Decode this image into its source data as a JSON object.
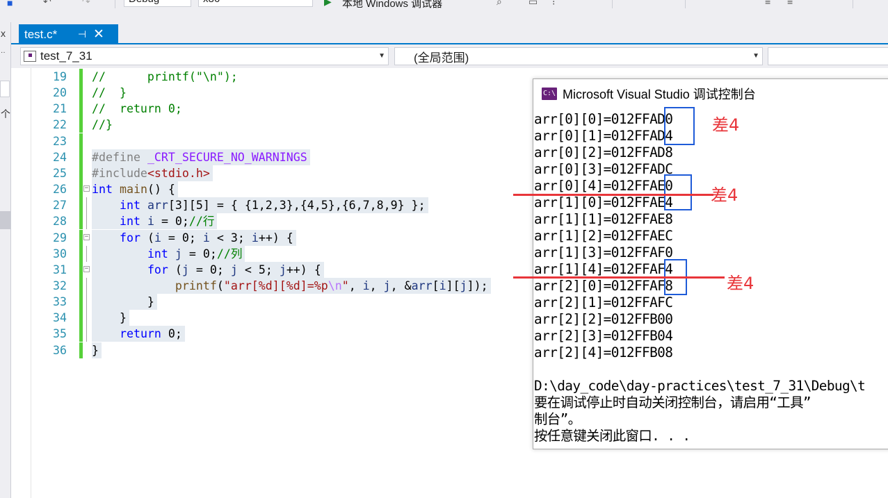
{
  "toolbar": {
    "config_value": "Debug",
    "platform_value": "x86",
    "run_label": "本地 Windows 调试器"
  },
  "left_strip": {
    "top_glyph": "x",
    "side_text": "个"
  },
  "tab": {
    "title": "test.c*",
    "pin_glyph": "⊣",
    "close_glyph": "✕"
  },
  "navbar": {
    "project_value": "test_7_31",
    "scope_value": "(全局范围)"
  },
  "editor": {
    "lines": [
      {
        "num": "19",
        "html": "<span class=\"tk-cm\">//      printf(\"\\n\");</span>"
      },
      {
        "num": "20",
        "html": "<span class=\"tk-cm\">//  }</span>"
      },
      {
        "num": "21",
        "html": "<span class=\"tk-cm\">//  return 0;</span>"
      },
      {
        "num": "22",
        "html": "<span class=\"tk-cm\">//}</span>"
      },
      {
        "num": "23",
        "html": ""
      },
      {
        "num": "24",
        "html": "<span class=\"tk-pp\">#define </span><span class=\"tk-mac\">_CRT_SECURE_NO_WARNINGS</span>"
      },
      {
        "num": "25",
        "html": "<span class=\"tk-pp\">#include</span><span class=\"tk-str\">&lt;stdio.h&gt;</span>"
      },
      {
        "num": "26",
        "html": "<span class=\"tk-kw\">int</span> <span class=\"tk-fn\">main</span>() {"
      },
      {
        "num": "27",
        "html": "    <span class=\"tk-kw\">int</span> <span class=\"tk-var\">arr</span>[3][5] = { {1,2,3},{4,5},{6,7,8,9} };"
      },
      {
        "num": "28",
        "html": "    <span class=\"tk-kw\">int</span> <span class=\"tk-var\">i</span> = 0;<span class=\"tk-cm\">//行</span>"
      },
      {
        "num": "29",
        "html": "    <span class=\"tk-kw\">for</span> (<span class=\"tk-var\">i</span> = 0; <span class=\"tk-var\">i</span> &lt; 3; <span class=\"tk-var\">i</span>++) {"
      },
      {
        "num": "30",
        "html": "        <span class=\"tk-kw\">int</span> <span class=\"tk-var\">j</span> = 0;<span class=\"tk-cm\">//列</span>"
      },
      {
        "num": "31",
        "html": "        <span class=\"tk-kw\">for</span> (<span class=\"tk-var\">j</span> = 0; <span class=\"tk-var\">j</span> &lt; 5; <span class=\"tk-var\">j</span>++) {"
      },
      {
        "num": "32",
        "html": "            <span class=\"tk-fn\">printf</span>(<span class=\"tk-str\">\"arr[%d][%d]=%p</span><span class=\"tk-esc\">\\n</span><span class=\"tk-str\">\"</span>, <span class=\"tk-var\">i</span>, <span class=\"tk-var\">j</span>, &amp;<span class=\"tk-var\">arr</span>[<span class=\"tk-var\">i</span>][<span class=\"tk-var\">j</span>]);"
      },
      {
        "num": "33",
        "html": "        }"
      },
      {
        "num": "34",
        "html": "    }"
      },
      {
        "num": "35",
        "html": "    <span class=\"tk-kw\">return</span> 0;"
      },
      {
        "num": "36",
        "html": "}"
      }
    ]
  },
  "console": {
    "title": "Microsoft Visual Studio 调试控制台",
    "icon_text": "C:\\",
    "lines": [
      "arr[0][0]=012FFAD0",
      "arr[0][1]=012FFAD4",
      "arr[0][2]=012FFAD8",
      "arr[0][3]=012FFADC",
      "arr[0][4]=012FFAE0",
      "arr[1][0]=012FFAE4",
      "arr[1][1]=012FFAE8",
      "arr[1][2]=012FFAEC",
      "arr[1][3]=012FFAF0",
      "arr[1][4]=012FFAF4",
      "arr[2][0]=012FFAF8",
      "arr[2][1]=012FFAFC",
      "arr[2][2]=012FFB00",
      "arr[2][3]=012FFB04",
      "arr[2][4]=012FFB08",
      "",
      "D:\\day_code\\day-practices\\test_7_31\\Debug\\t",
      "要在调试停止时自动关闭控制台，请启用“工具”",
      "制台”。",
      "按任意键关闭此窗口. . ."
    ]
  },
  "annotations": {
    "label_1": "差4",
    "label_2": "差4",
    "label_3": "差4"
  },
  "colors": {
    "accent": "#007acc",
    "annotation_red": "#e8353a",
    "annotation_blue": "#1e5bd8"
  }
}
